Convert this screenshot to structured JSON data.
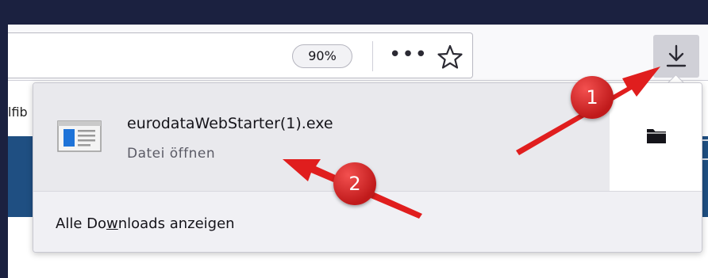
{
  "toolbar": {
    "zoom_level": "90%",
    "more_icon": "more-horizontal-icon",
    "bookmark_icon": "star-icon",
    "downloads_icon": "download-arrow-icon"
  },
  "page": {
    "visible_text": "lfib"
  },
  "downloads_panel": {
    "item": {
      "file_name": "eurodataWebStarter(1).exe",
      "status": "Datei öffnen",
      "file_icon": "exe-window-icon",
      "folder_icon": "folder-icon"
    },
    "footer": {
      "label_before": "Alle Do",
      "label_accesskey": "w",
      "label_after": "nloads anzeigen"
    }
  },
  "annotations": {
    "callout_1": "1",
    "callout_2": "2",
    "color": "#e02222"
  }
}
